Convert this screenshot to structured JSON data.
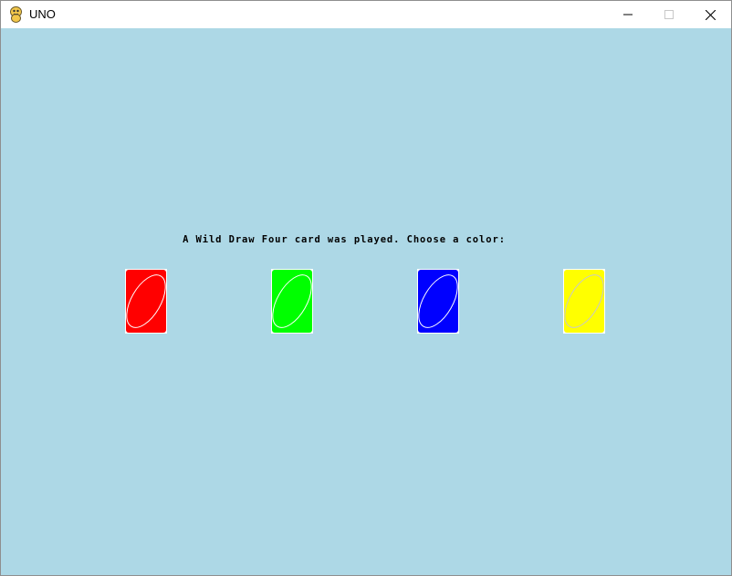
{
  "window": {
    "title": "UNO"
  },
  "controls": {
    "minimize_icon": "minimize-icon",
    "maximize_icon": "maximize-icon",
    "close_icon": "close-icon"
  },
  "game": {
    "prompt": "A Wild Draw Four card was played. Choose a color:",
    "cards": [
      {
        "color_name": "red",
        "fill": "#ff0000"
      },
      {
        "color_name": "green",
        "fill": "#00ff00"
      },
      {
        "color_name": "blue",
        "fill": "#0000ff"
      },
      {
        "color_name": "yellow",
        "fill": "#ffff00"
      }
    ]
  },
  "colors": {
    "background": "#add8e6",
    "card_border": "#ffffff"
  }
}
